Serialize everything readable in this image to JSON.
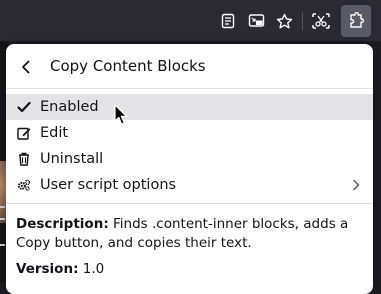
{
  "toolbar": {
    "icons": [
      "reader-view-icon",
      "picture-in-picture-icon",
      "bookmark-star-icon",
      "screenshot-icon",
      "extensions-icon"
    ]
  },
  "popup": {
    "title": "Copy Content Blocks",
    "menu": [
      {
        "label": "Enabled",
        "icon": "checkmark-icon",
        "hovered": true
      },
      {
        "label": "Edit",
        "icon": "edit-icon"
      },
      {
        "label": "Uninstall",
        "icon": "trash-icon"
      },
      {
        "label": "User script options",
        "icon": "gears-icon",
        "has_submenu": true
      }
    ],
    "description_label": "Description:",
    "description_text": " Finds .content-inner blocks, adds a Copy button, and copies their text.",
    "version_label": "Version:",
    "version_value": " 1.0"
  },
  "colors": {
    "toolbar_bg": "#2b2a33",
    "popup_bg": "#ffffff",
    "hover_bg": "#e3e3e6",
    "text": "#15141a"
  }
}
